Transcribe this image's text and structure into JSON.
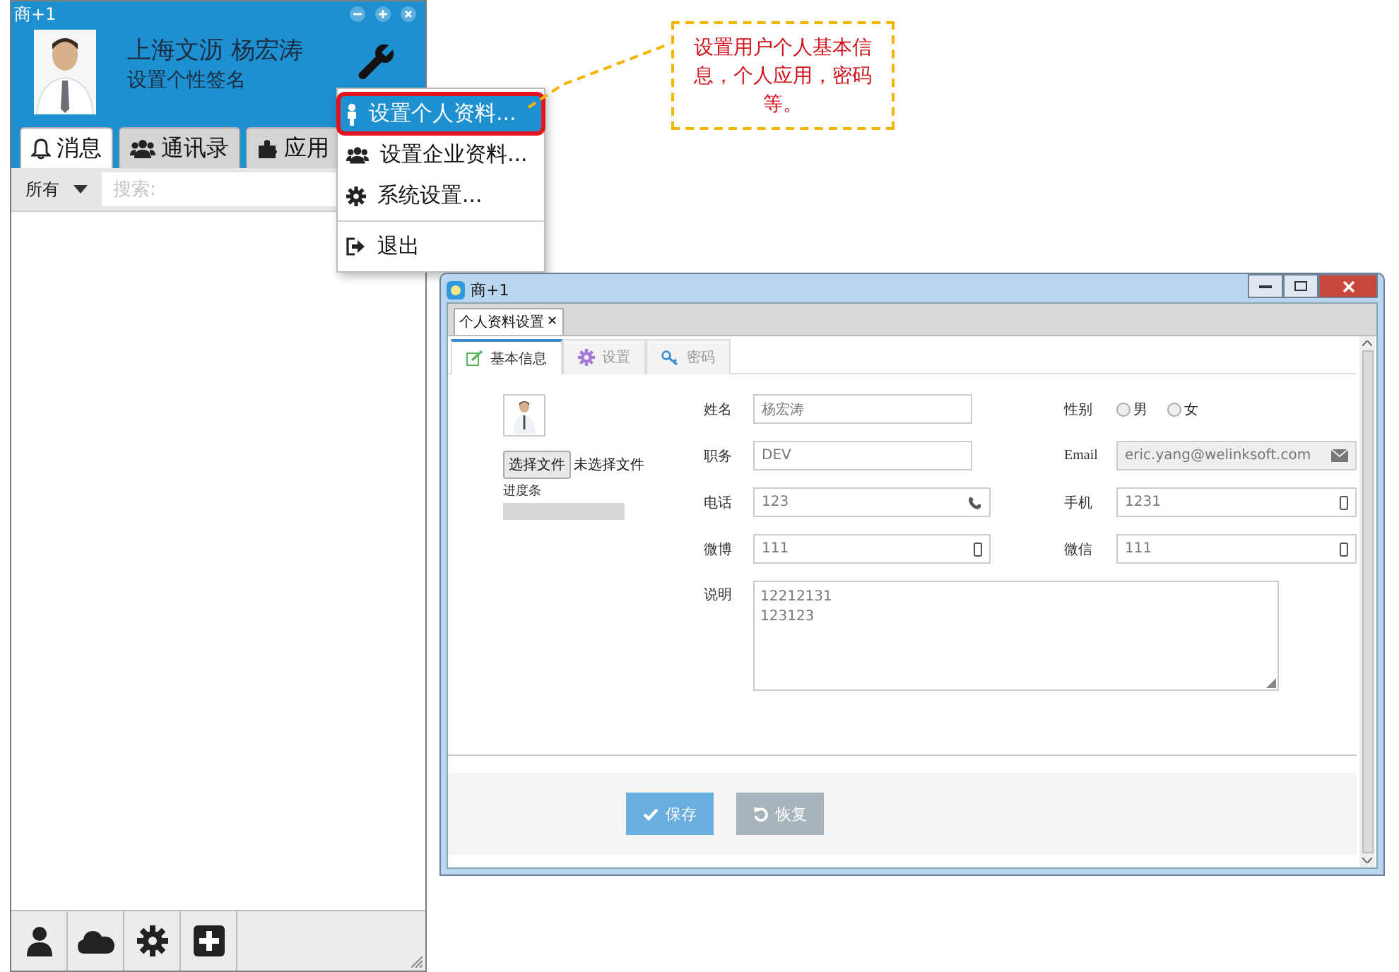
{
  "left_window": {
    "title": "商+1",
    "user_name": "上海文沥 杨宏涛",
    "signature": "设置个性签名",
    "tabs": [
      {
        "label": "消息",
        "selected": true
      },
      {
        "label": "通讯录",
        "selected": false
      },
      {
        "label": "应用",
        "selected": false
      }
    ],
    "filter": "所有",
    "search": {
      "placeholder": "搜索:"
    }
  },
  "menu": {
    "groups": [
      [
        {
          "label": "设置个人资料...",
          "selected": true
        },
        {
          "label": "设置企业资料...",
          "selected": false
        },
        {
          "label": "系统设置...",
          "selected": false
        }
      ],
      [
        {
          "label": "退出",
          "selected": false
        }
      ]
    ]
  },
  "callout": {
    "text": "设置用户个人基本信息，个人应用，密码等。"
  },
  "profile_window": {
    "title": "商+1",
    "doc_tab": {
      "label": "个人资料设置",
      "close": "✕"
    },
    "tabs": [
      {
        "label": "基本信息",
        "selected": true
      },
      {
        "label": "设置",
        "selected": false
      },
      {
        "label": "密码",
        "selected": false
      }
    ],
    "file_button": "选择文件",
    "file_status": "未选择文件",
    "progress": {
      "label": "进度条",
      "level": 0
    },
    "left_fields": [
      {
        "label": "姓名",
        "value": "杨宏涛",
        "kind": "text",
        "readonly": false
      },
      {
        "label": "职务",
        "value": "DEV",
        "kind": "text",
        "readonly": false
      },
      {
        "label": "电话",
        "value": "123",
        "kind": "phone",
        "readonly": false
      },
      {
        "label": "微博",
        "value": "111",
        "kind": "mobile",
        "readonly": false
      }
    ],
    "right_fields": [
      {
        "label": "性别",
        "kind": "radio",
        "options": [
          {
            "label": "男",
            "checked": false
          },
          {
            "label": "女",
            "checked": false
          }
        ]
      },
      {
        "label": "Email",
        "value": "eric.yang@welinksoft.com",
        "kind": "email",
        "readonly": true
      },
      {
        "label": "手机",
        "value": "1231",
        "kind": "mobile",
        "readonly": false
      },
      {
        "label": "微信",
        "value": "111",
        "kind": "mobile",
        "readonly": false
      }
    ],
    "notes": {
      "label": "说明",
      "value": "12212131\n123123"
    },
    "buttons": [
      {
        "label": "保存",
        "kind": "primary"
      },
      {
        "label": "恢复",
        "kind": "secondary"
      }
    ]
  }
}
